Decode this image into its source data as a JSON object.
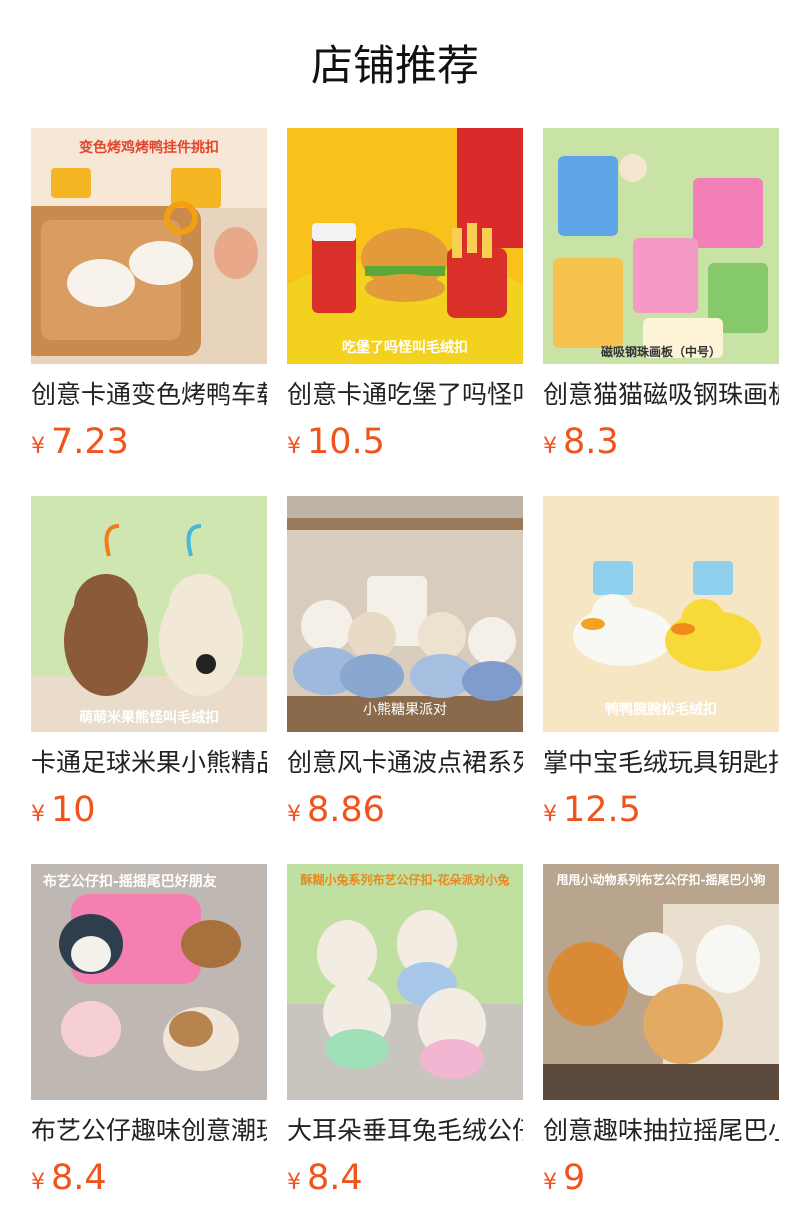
{
  "page": {
    "title": "店铺推荐"
  },
  "products": [
    {
      "name": "创意卡通变色烤鸭车载钥匙扣",
      "currency": "¥",
      "price": "7.23",
      "image_caption": "变色烤鸡烤鸭挂件挑扣"
    },
    {
      "name": "创意卡通吃堡了吗怪叫毛绒扣",
      "currency": "¥",
      "price": "10.5",
      "image_caption": "吃堡了吗怪叫毛绒扣"
    },
    {
      "name": "创意猫猫磁吸钢珠画板",
      "currency": "¥",
      "price": "8.3",
      "image_caption": "磁吸钢珠画板（中号）"
    },
    {
      "name": "卡通足球米果小熊精品挂件",
      "currency": "¥",
      "price": "10",
      "image_caption": "萌萌米果熊怪叫毛绒扣"
    },
    {
      "name": "创意风卡通波点裙系列小熊",
      "currency": "¥",
      "price": "8.86",
      "image_caption": "小熊糖果派对"
    },
    {
      "name": "掌中宝毛绒玩具钥匙扣",
      "currency": "¥",
      "price": "12.5",
      "image_caption": "鸭鸭腕腕松毛绒扣"
    },
    {
      "name": "布艺公仔趣味创意潮玩挂件",
      "currency": "¥",
      "price": "8.4",
      "image_caption": "布艺公仔扣-摇摇尾巴好朋友"
    },
    {
      "name": "大耳朵垂耳兔毛绒公仔挂件",
      "currency": "¥",
      "price": "8.4",
      "image_caption": "酥糊小兔系列布艺公仔扣-花朵派对小兔"
    },
    {
      "name": "创意趣味抽拉摇尾巴小狗",
      "currency": "¥",
      "price": "9",
      "image_caption": "甩甩小动物系列布艺公仔扣-摇尾巴小狗"
    }
  ],
  "colors": {
    "price": "#f0541c",
    "title": "#111111",
    "name": "#222222"
  },
  "icons": [
    "duck-keychain-image",
    "burger-plush-image",
    "bead-board-image",
    "bear-plush-image",
    "bear-dress-image",
    "duck-plush-image",
    "animal-plush-image",
    "bunny-plush-image",
    "dog-plush-image"
  ]
}
